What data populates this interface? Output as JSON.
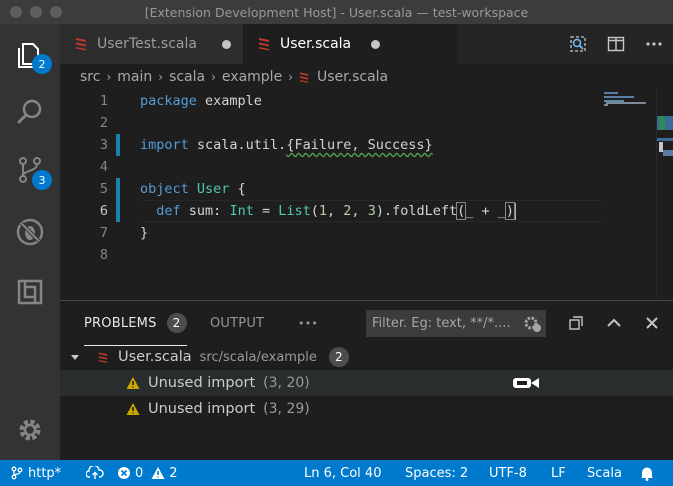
{
  "window": {
    "title": "[Extension Development Host] - User.scala — test-workspace"
  },
  "activity": {
    "explorer_badge": "2",
    "scm_badge": "3"
  },
  "tabs": [
    {
      "label": "UserTest.scala",
      "dirty": true
    },
    {
      "label": "User.scala",
      "dirty": true,
      "active": true
    }
  ],
  "breadcrumb": [
    "src",
    "main",
    "scala",
    "example",
    "User.scala"
  ],
  "editor": {
    "line_numbers": [
      "1",
      "2",
      "3",
      "4",
      "5",
      "6",
      "7",
      "8"
    ],
    "current_line": "6",
    "code": {
      "l1_kw": "package",
      "l1_rest": " example",
      "l3_kw": "import",
      "l3_a": " scala.util.",
      "l3_b": "{Failure, Success}",
      "l5_kw": "object",
      "l5_ty": " User",
      "l5_rest": " {",
      "l6_indent": "  ",
      "l6_kw": "def",
      "l6_a": " sum: ",
      "l6_ty": "Int",
      "l6_b": " = ",
      "l6_ty2": "List",
      "l6_c": "(",
      "l6_n1": "1",
      "l6_d": ", ",
      "l6_n2": "2",
      "l6_e": ", ",
      "l6_n3": "3",
      "l6_f": ").foldLeft",
      "l6_open": "(",
      "l6_g": "_ + _",
      "l6_close": ")",
      "l7": "}"
    }
  },
  "panel": {
    "tabs": {
      "problems": "PROBLEMS",
      "problems_count": "2",
      "output": "OUTPUT",
      "more": "•••"
    },
    "filter_placeholder": "Filter. Eg: text, **/*....",
    "file": {
      "name": "User.scala",
      "path": "src/scala/example",
      "count": "2"
    },
    "problems": [
      {
        "message": "Unused import",
        "location": "(3, 20)"
      },
      {
        "message": "Unused import",
        "location": "(3, 29)"
      }
    ]
  },
  "status": {
    "branch": "http*",
    "errors": "0",
    "warnings": "2",
    "position": "Ln 6, Col 40",
    "spaces": "Spaces: 2",
    "encoding": "UTF-8",
    "eol": "LF",
    "language": "Scala"
  },
  "colors": {
    "accent": "#007acc",
    "keyword": "#569cd6",
    "type": "#4ec9b0",
    "number": "#b5cea8",
    "warning": "#cca700"
  }
}
